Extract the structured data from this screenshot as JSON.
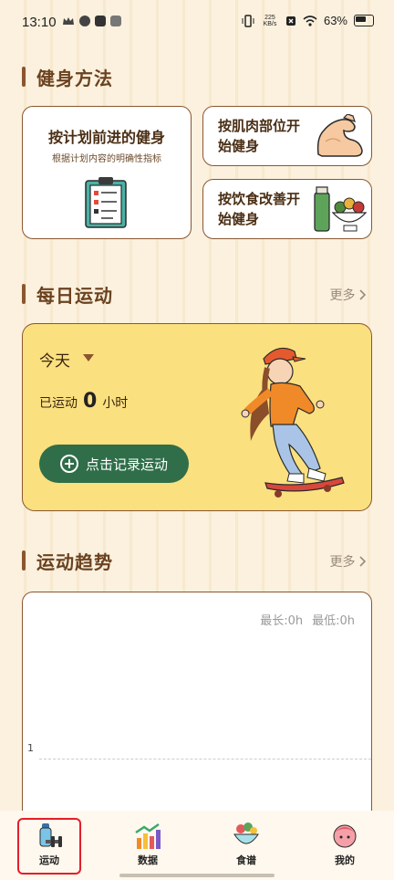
{
  "status": {
    "time": "13:10",
    "net_speed": "225 KB/s",
    "battery": "63%"
  },
  "fitness_methods": {
    "title": "健身方法",
    "plan_card": {
      "title": "按计划前进的健身",
      "subtitle": "根据计划内容的明确性指标"
    },
    "muscle_card": {
      "label": "按肌肉部位开始健身"
    },
    "diet_card": {
      "label": "按饮食改善开始健身"
    }
  },
  "daily_exercise": {
    "title": "每日运动",
    "more": "更多 ",
    "day": "今天",
    "exercised_prefix": "已运动",
    "exercised_value": "0",
    "exercised_unit": "小时",
    "record_button": "点击记录运动"
  },
  "trend": {
    "title": "运动趋势",
    "more": "更多 ",
    "max": "最长:0h",
    "min": "最低:0h",
    "axis_value": "1"
  },
  "tabs": [
    {
      "label": "运动",
      "icon": "dumbbell-icon",
      "selected": true
    },
    {
      "label": "数据",
      "icon": "bar-chart-icon"
    },
    {
      "label": "食谱",
      "icon": "salad-bowl-icon"
    },
    {
      "label": "我的",
      "icon": "avatar-icon"
    }
  ],
  "colors": {
    "accent": "#8a5630",
    "card_yellow": "#fae07f",
    "button_green": "#2f6e49",
    "highlight": "#e51d2a"
  }
}
